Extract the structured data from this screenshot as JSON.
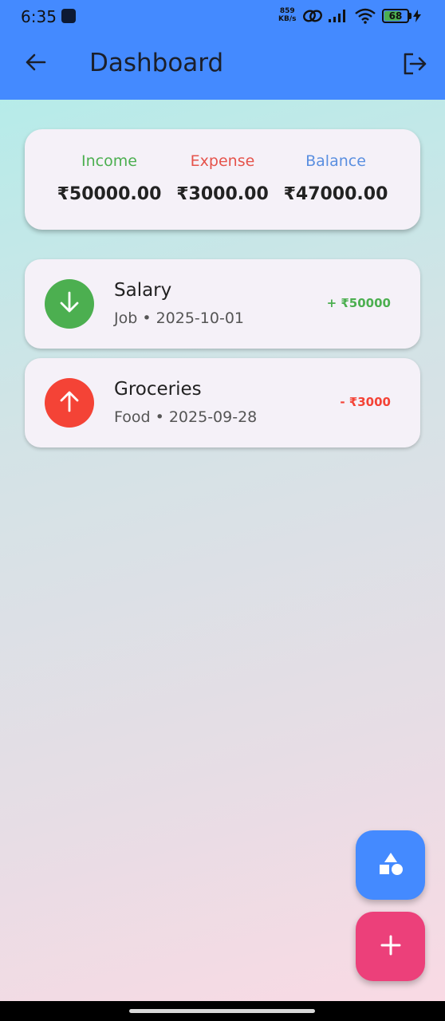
{
  "status_bar": {
    "time": "6:35",
    "net_speed_value": "859",
    "net_speed_unit": "KB/s",
    "battery_level": "68",
    "battery_fraction": 0.68
  },
  "app_bar": {
    "title": "Dashboard",
    "color": "#448aff"
  },
  "summary": {
    "income_label": "Income",
    "income_value": "₹50000.00",
    "income_color": "#4caf50",
    "expense_label": "Expense",
    "expense_value": "₹3000.00",
    "expense_color": "#e5534b",
    "balance_label": "Balance",
    "balance_value": "₹47000.00",
    "balance_color": "#5a8fe0"
  },
  "transactions": [
    {
      "title": "Salary",
      "subtitle": "Job • 2025-10-01",
      "amount": "+ ₹50000",
      "type": "income",
      "icon": "arrow-down-icon",
      "color": "#4caf50"
    },
    {
      "title": "Groceries",
      "subtitle": "Food • 2025-09-28",
      "amount": "- ₹3000",
      "type": "expense",
      "icon": "arrow-up-icon",
      "color": "#f44336"
    }
  ],
  "fabs": {
    "categories_icon": "shapes-icon",
    "categories_color": "#448aff",
    "add_icon": "plus-icon",
    "add_color": "#ec407a"
  }
}
